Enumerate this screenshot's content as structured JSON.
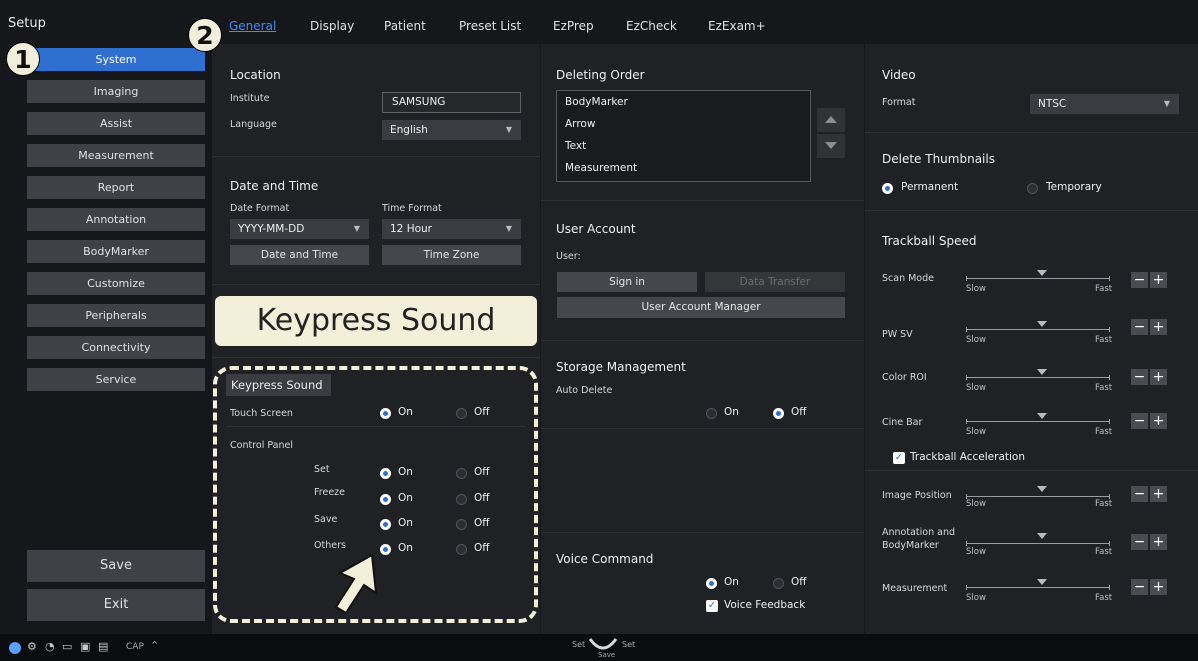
{
  "sidebar": {
    "setup_label": "Setup",
    "items": [
      "System",
      "Imaging",
      "Assist",
      "Measurement",
      "Report",
      "Annotation",
      "BodyMarker",
      "Customize",
      "Peripherals",
      "Connectivity",
      "Service"
    ],
    "save_label": "Save",
    "exit_label": "Exit"
  },
  "badges": {
    "one": "1",
    "two": "2"
  },
  "tabs": [
    "General",
    "Display",
    "Patient",
    "Preset List",
    "EzPrep",
    "EzCheck",
    "EzExam+"
  ],
  "location": {
    "title": "Location",
    "institute_label": "Institute",
    "institute_value": "SAMSUNG",
    "language_label": "Language",
    "language_value": "English"
  },
  "datetime": {
    "title": "Date and Time",
    "date_format_label": "Date Format",
    "date_format_value": "YYYY-MM-DD",
    "time_format_label": "Time Format",
    "time_format_value": "12 Hour",
    "date_time_button": "Date and Time",
    "time_zone_button": "Time Zone"
  },
  "callout": "Keypress Sound",
  "keypress": {
    "title": "Keypress Sound",
    "touch_screen_label": "Touch Screen",
    "control_panel_label": "Control Panel",
    "set_label": "Set",
    "freeze_label": "Freeze",
    "save_label": "Save",
    "others_label": "Others",
    "on": "On",
    "off": "Off"
  },
  "deleting_order": {
    "title": "Deleting Order",
    "items": [
      "BodyMarker",
      "Arrow",
      "Text",
      "Measurement"
    ]
  },
  "user_account": {
    "title": "User Account",
    "user_label": "User:",
    "sign_in": "Sign in",
    "data_transfer": "Data Transfer",
    "manager": "User Account Manager"
  },
  "storage": {
    "title": "Storage Management",
    "auto_delete_label": "Auto Delete",
    "on": "On",
    "off": "Off"
  },
  "voice": {
    "title": "Voice Command",
    "on": "On",
    "off": "Off",
    "feedback": "Voice Feedback"
  },
  "video": {
    "title": "Video",
    "format_label": "Format",
    "format_value": "NTSC"
  },
  "thumbnails": {
    "title": "Delete Thumbnails",
    "permanent": "Permanent",
    "temporary": "Temporary"
  },
  "trackball": {
    "title": "Trackball Speed",
    "slow": "Slow",
    "fast": "Fast",
    "acceleration": "Trackball Acceleration",
    "rows": [
      "Scan Mode",
      "PW SV",
      "Color ROI",
      "Cine Bar"
    ],
    "rows2": [
      "Image Position",
      "Annotation and",
      "BodyMarker",
      "Measurement"
    ],
    "minus": "−",
    "plus": "+"
  },
  "statusbar": {
    "cap": "CAP",
    "set_left": "Set",
    "set_right": "Set",
    "save": "Save"
  },
  "colors": {
    "accent": "#2f6fcf",
    "callout": "#f3efd9"
  }
}
